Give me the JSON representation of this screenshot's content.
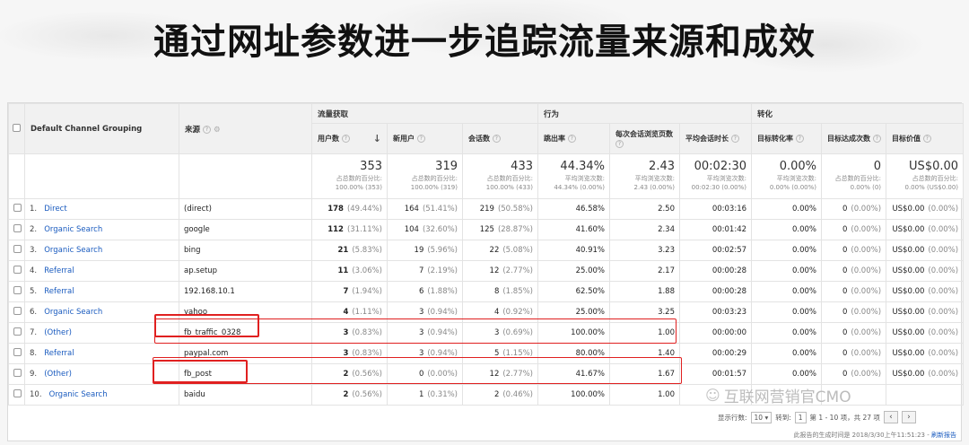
{
  "slide_title": "通过网址参数进一步追踪流量来源和成效",
  "table": {
    "group_headers": {
      "acquisition": "流量获取",
      "behavior": "行为",
      "conversion": "转化"
    },
    "col_channel": "Default Channel Grouping",
    "col_source": "来源",
    "metrics": [
      "用户数",
      "新用户",
      "会话数",
      "跳出率",
      "每次会话浏览页数",
      "平均会话时长",
      "目标转化率",
      "目标达成次数",
      "目标价值"
    ],
    "totals": [
      {
        "value": "353",
        "sub1": "占总数的百分比:",
        "sub2": "100.00% (353)"
      },
      {
        "value": "319",
        "sub1": "占总数的百分比:",
        "sub2": "100.00% (319)"
      },
      {
        "value": "433",
        "sub1": "占总数的百分比:",
        "sub2": "100.00% (433)"
      },
      {
        "value": "44.34%",
        "sub1": "平均浏览次数:",
        "sub2": "44.34% (0.00%)"
      },
      {
        "value": "2.43",
        "sub1": "平均浏览次数:",
        "sub2": "2.43 (0.00%)"
      },
      {
        "value": "00:02:30",
        "sub1": "平均浏览次数:",
        "sub2": "00:02:30 (0.00%)"
      },
      {
        "value": "0.00%",
        "sub1": "平均浏览次数:",
        "sub2": "0.00% (0.00%)"
      },
      {
        "value": "0",
        "sub1": "占总数的百分比:",
        "sub2": "0.00% (0)"
      },
      {
        "value": "US$0.00",
        "sub1": "占总数的百分比:",
        "sub2": "0.00% (US$0.00)"
      }
    ],
    "rows": [
      {
        "idx": "1.",
        "channel": "Direct",
        "source": "(direct)",
        "users": "178",
        "users_pct": "(49.44%)",
        "new": "164",
        "new_pct": "(51.41%)",
        "sessions": "219",
        "sessions_pct": "(50.58%)",
        "bounce": "46.58%",
        "pages": "2.50",
        "duration": "00:03:16",
        "conv": "0.00%",
        "goals": "0",
        "goals_pct": "(0.00%)",
        "value": "US$0.00",
        "value_pct": "(0.00%)"
      },
      {
        "idx": "2.",
        "channel": "Organic Search",
        "source": "google",
        "users": "112",
        "users_pct": "(31.11%)",
        "new": "104",
        "new_pct": "(32.60%)",
        "sessions": "125",
        "sessions_pct": "(28.87%)",
        "bounce": "41.60%",
        "pages": "2.34",
        "duration": "00:01:42",
        "conv": "0.00%",
        "goals": "0",
        "goals_pct": "(0.00%)",
        "value": "US$0.00",
        "value_pct": "(0.00%)"
      },
      {
        "idx": "3.",
        "channel": "Organic Search",
        "source": "bing",
        "users": "21",
        "users_pct": "(5.83%)",
        "new": "19",
        "new_pct": "(5.96%)",
        "sessions": "22",
        "sessions_pct": "(5.08%)",
        "bounce": "40.91%",
        "pages": "3.23",
        "duration": "00:02:57",
        "conv": "0.00%",
        "goals": "0",
        "goals_pct": "(0.00%)",
        "value": "US$0.00",
        "value_pct": "(0.00%)"
      },
      {
        "idx": "4.",
        "channel": "Referral",
        "source": "ap.setup",
        "users": "11",
        "users_pct": "(3.06%)",
        "new": "7",
        "new_pct": "(2.19%)",
        "sessions": "12",
        "sessions_pct": "(2.77%)",
        "bounce": "25.00%",
        "pages": "2.17",
        "duration": "00:00:28",
        "conv": "0.00%",
        "goals": "0",
        "goals_pct": "(0.00%)",
        "value": "US$0.00",
        "value_pct": "(0.00%)"
      },
      {
        "idx": "5.",
        "channel": "Referral",
        "source": "192.168.10.1",
        "users": "7",
        "users_pct": "(1.94%)",
        "new": "6",
        "new_pct": "(1.88%)",
        "sessions": "8",
        "sessions_pct": "(1.85%)",
        "bounce": "62.50%",
        "pages": "1.88",
        "duration": "00:00:28",
        "conv": "0.00%",
        "goals": "0",
        "goals_pct": "(0.00%)",
        "value": "US$0.00",
        "value_pct": "(0.00%)"
      },
      {
        "idx": "6.",
        "channel": "Organic Search",
        "source": "yahoo",
        "users": "4",
        "users_pct": "(1.11%)",
        "new": "3",
        "new_pct": "(0.94%)",
        "sessions": "4",
        "sessions_pct": "(0.92%)",
        "bounce": "25.00%",
        "pages": "3.25",
        "duration": "00:03:23",
        "conv": "0.00%",
        "goals": "0",
        "goals_pct": "(0.00%)",
        "value": "US$0.00",
        "value_pct": "(0.00%)"
      },
      {
        "idx": "7.",
        "channel": "(Other)",
        "source": "fb_traffic_0328",
        "users": "3",
        "users_pct": "(0.83%)",
        "new": "3",
        "new_pct": "(0.94%)",
        "sessions": "3",
        "sessions_pct": "(0.69%)",
        "bounce": "100.00%",
        "pages": "1.00",
        "duration": "00:00:00",
        "conv": "0.00%",
        "goals": "0",
        "goals_pct": "(0.00%)",
        "value": "US$0.00",
        "value_pct": "(0.00%)"
      },
      {
        "idx": "8.",
        "channel": "Referral",
        "source": "paypal.com",
        "users": "3",
        "users_pct": "(0.83%)",
        "new": "3",
        "new_pct": "(0.94%)",
        "sessions": "5",
        "sessions_pct": "(1.15%)",
        "bounce": "80.00%",
        "pages": "1.40",
        "duration": "00:00:29",
        "conv": "0.00%",
        "goals": "0",
        "goals_pct": "(0.00%)",
        "value": "US$0.00",
        "value_pct": "(0.00%)"
      },
      {
        "idx": "9.",
        "channel": "(Other)",
        "source": "fb_post",
        "users": "2",
        "users_pct": "(0.56%)",
        "new": "0",
        "new_pct": "(0.00%)",
        "sessions": "12",
        "sessions_pct": "(2.77%)",
        "bounce": "41.67%",
        "pages": "1.67",
        "duration": "00:01:57",
        "conv": "0.00%",
        "goals": "0",
        "goals_pct": "(0.00%)",
        "value": "US$0.00",
        "value_pct": "(0.00%)"
      },
      {
        "idx": "10.",
        "channel": "Organic Search",
        "source": "baidu",
        "users": "2",
        "users_pct": "(0.56%)",
        "new": "1",
        "new_pct": "(0.31%)",
        "sessions": "2",
        "sessions_pct": "(0.46%)",
        "bounce": "100.00%",
        "pages": "1.00",
        "duration": "",
        "conv": "",
        "goals": "",
        "goals_pct": "",
        "value": "",
        "value_pct": ""
      }
    ]
  },
  "footer": {
    "rows_label": "显示行数:",
    "rows_value": "10",
    "goto_label": "转到:",
    "goto_value": "1",
    "range_text": "第 1 - 10 项，共 27 项",
    "prev": "‹",
    "next": "›",
    "report_time": "此报告的生成时间是 2018/3/30上午11:51:23 -",
    "refresh": "刷新报告"
  },
  "watermark": "互联网营销官CMO",
  "colors": {
    "highlight": "#e02020",
    "link": "#1a5bbf"
  }
}
